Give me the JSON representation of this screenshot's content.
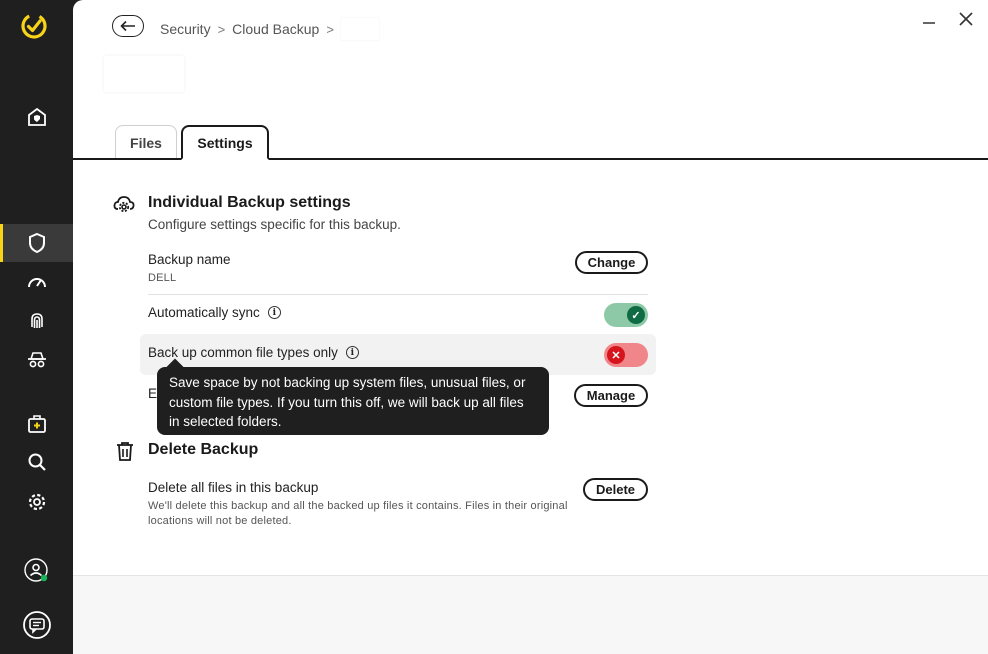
{
  "sidebar": {
    "logo_icon": "norton-check-logo",
    "items": [
      {
        "name": "home",
        "icon": "home-shield-icon"
      },
      {
        "name": "security",
        "icon": "shield-icon",
        "active": true
      },
      {
        "name": "performance",
        "icon": "speedometer-icon"
      },
      {
        "name": "identity",
        "icon": "fingerprint-icon"
      },
      {
        "name": "privacy",
        "icon": "incognito-icon"
      },
      {
        "name": "kit",
        "icon": "first-aid-icon"
      },
      {
        "name": "search",
        "icon": "search-icon"
      },
      {
        "name": "settings",
        "icon": "gear-icon"
      },
      {
        "name": "account",
        "icon": "user-icon"
      },
      {
        "name": "chat",
        "icon": "chat-icon"
      }
    ],
    "accent": "#f7d417"
  },
  "window": {
    "minimize": "—",
    "close": "✕"
  },
  "breadcrumb": {
    "items": [
      "Security",
      "Cloud Backup"
    ],
    "separator": ">"
  },
  "tabs": [
    {
      "label": "Files",
      "active": false
    },
    {
      "label": "Settings",
      "active": true
    }
  ],
  "individual": {
    "title": "Individual Backup settings",
    "subtitle": "Configure settings specific for this backup.",
    "backup_name_label": "Backup name",
    "backup_name_value": "DELL",
    "change_label": "Change",
    "auto_sync_label": "Automatically sync",
    "auto_sync_on": true,
    "common_types_label": "Back up common file types only",
    "common_types_on": false,
    "hidden_row_initial": "E",
    "manage_label": "Manage"
  },
  "tooltip": {
    "text": "Save space by not backing up system files, unusual files, or custom file types. If you turn this off, we will back up all files in selected folders."
  },
  "delete_section": {
    "title": "Delete Backup",
    "row_label": "Delete all files in this backup",
    "row_desc": "We'll delete this backup and all the backed up files it contains. Files in their original locations will not be deleted.",
    "delete_label": "Delete"
  },
  "colors": {
    "toggle_on": "#8dc9a6",
    "toggle_on_knob": "#0f6b43",
    "toggle_off": "#f0868a",
    "toggle_off_knob": "#d6141d"
  }
}
